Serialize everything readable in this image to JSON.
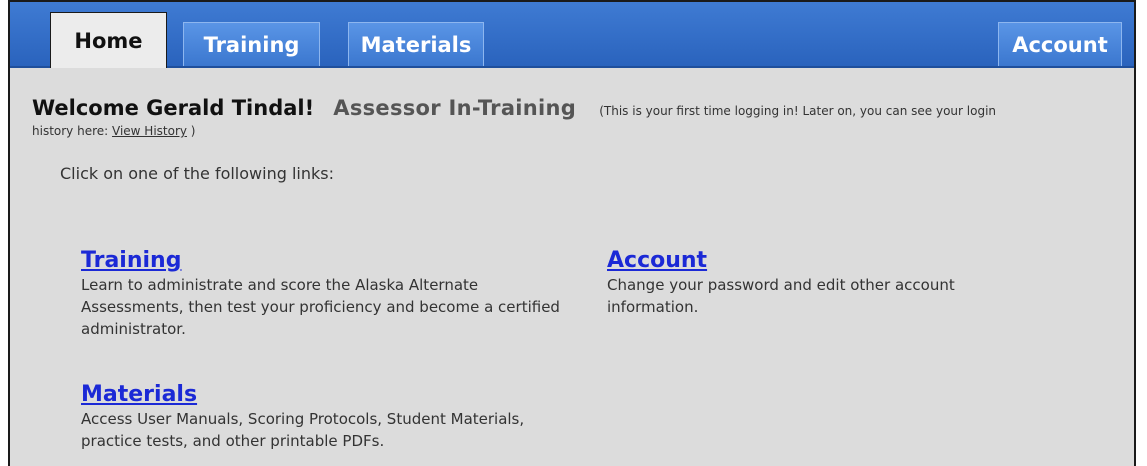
{
  "nav": {
    "tabs": [
      {
        "label": "Home",
        "active": true
      },
      {
        "label": "Training",
        "active": false
      },
      {
        "label": "Materials",
        "active": false
      }
    ],
    "account_label": "Account"
  },
  "welcome": {
    "greeting": "Welcome Gerald Tindal!",
    "role": "Assessor In-Training",
    "note": "(This is your first time logging in! Later on, you can see your login",
    "history_prefix": "history here: ",
    "history_link": "View History",
    "history_suffix": " )"
  },
  "instruction": "Click on one of the following links:",
  "links": {
    "training": {
      "title": "Training",
      "description": "Learn to administrate and score the Alaska Alternate Assessments, then test your proficiency and become a certified administrator."
    },
    "account": {
      "title": "Account",
      "description": "Change your password and edit other account information."
    },
    "materials": {
      "title": "Materials",
      "description": "Access User Manuals, Scoring Protocols, Student Materials, practice tests, and other printable PDFs."
    }
  },
  "colors": {
    "nav_blue": "#2a63bd",
    "link_blue": "#1b29d6",
    "page_bg": "#dcdcdc"
  }
}
